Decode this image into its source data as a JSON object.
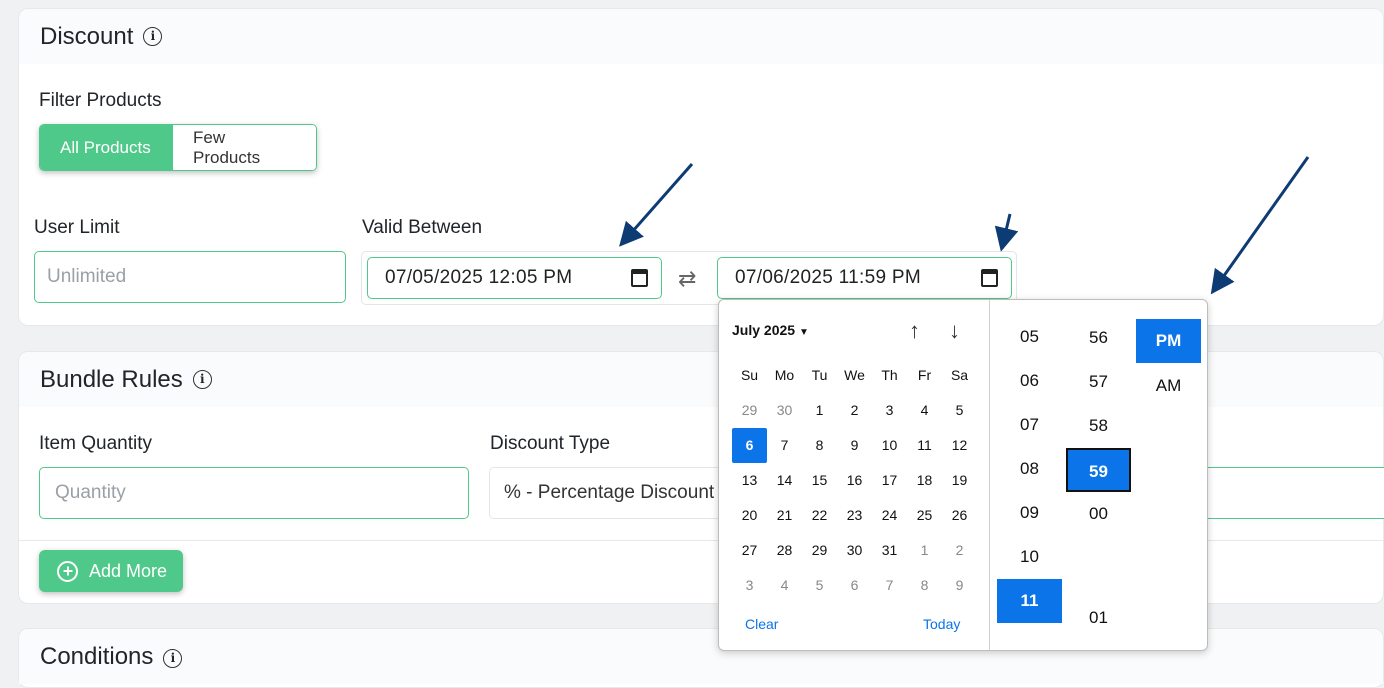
{
  "discount": {
    "title": "Discount",
    "filter_label": "Filter Products",
    "filter_options": [
      "All Products",
      "Few Products"
    ],
    "user_limit_label": "User Limit",
    "user_limit_placeholder": "Unlimited",
    "valid_between_label": "Valid Between",
    "start_datetime": "07/05/2025 12:05 PM",
    "end_datetime": "07/06/2025 11:59 PM"
  },
  "bundle": {
    "title": "Bundle Rules",
    "item_quantity_label": "Item Quantity",
    "quantity_placeholder": "Quantity",
    "discount_type_label": "Discount Type",
    "discount_type_value": "% - Percentage Discount",
    "add_more_label": "Add More"
  },
  "conditions": {
    "title": "Conditions"
  },
  "datepicker": {
    "month_label": "July 2025",
    "weekdays": [
      "Su",
      "Mo",
      "Tu",
      "We",
      "Th",
      "Fr",
      "Sa"
    ],
    "weeks": [
      [
        "29",
        "30",
        "1",
        "2",
        "3",
        "4",
        "5"
      ],
      [
        "6",
        "7",
        "8",
        "9",
        "10",
        "11",
        "12"
      ],
      [
        "13",
        "14",
        "15",
        "16",
        "17",
        "18",
        "19"
      ],
      [
        "20",
        "21",
        "22",
        "23",
        "24",
        "25",
        "26"
      ],
      [
        "27",
        "28",
        "29",
        "30",
        "31",
        "1",
        "2"
      ],
      [
        "3",
        "4",
        "5",
        "6",
        "7",
        "8",
        "9"
      ]
    ],
    "selected_day": "6",
    "clear_label": "Clear",
    "today_label": "Today",
    "hours": [
      "05",
      "06",
      "07",
      "08",
      "09",
      "10",
      "11"
    ],
    "selected_hour": "11",
    "minutes": [
      "56",
      "57",
      "58",
      "59",
      "00",
      "01"
    ],
    "selected_minute": "59",
    "meridiem": [
      "PM",
      "AM"
    ],
    "selected_meridiem": "PM"
  },
  "colors": {
    "accent_green": "#4fc98a",
    "picker_blue": "#0a74e8",
    "annotation_arrow": "#0d3b73"
  }
}
